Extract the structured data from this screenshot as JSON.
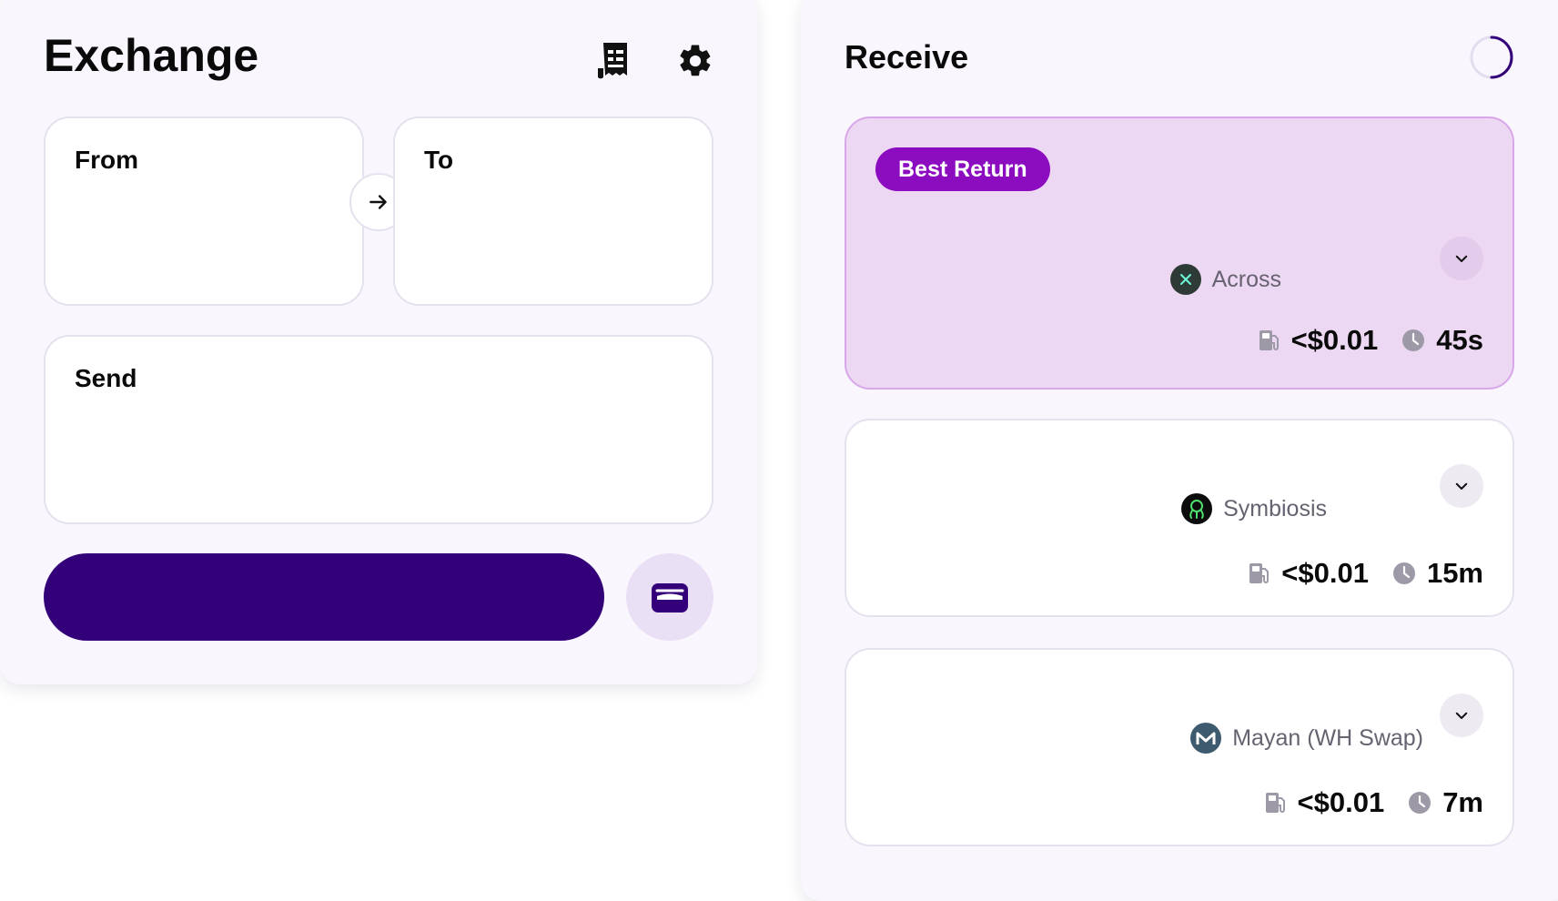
{
  "exchange": {
    "title": "Exchange",
    "icons": {
      "history": "receipt-icon",
      "settings": "gear-icon",
      "swap": "arrow-right-icon",
      "wallet": "wallet-icon"
    },
    "from_label": "From",
    "to_label": "To",
    "send_label": "Send",
    "primary_button_label": ""
  },
  "receive": {
    "title": "Receive",
    "loading": "spinner-icon",
    "routes": [
      {
        "badge": "Best Return",
        "provider": "Across",
        "logo": "across-logo",
        "fee": "<$0.01",
        "time": "45s",
        "selected": true
      },
      {
        "badge": "",
        "provider": "Symbiosis",
        "logo": "symbiosis-logo",
        "fee": "<$0.01",
        "time": "15m",
        "selected": false
      },
      {
        "badge": "",
        "provider": "Mayan (WH Swap)",
        "logo": "mayan-logo",
        "fee": "<$0.01",
        "time": "7m",
        "selected": false
      }
    ]
  },
  "colors": {
    "accent": "#33007a",
    "best_badge": "#8c0cc0",
    "best_card_bg": "#ecd8f3",
    "panel_bg": "#f9f6fd"
  }
}
